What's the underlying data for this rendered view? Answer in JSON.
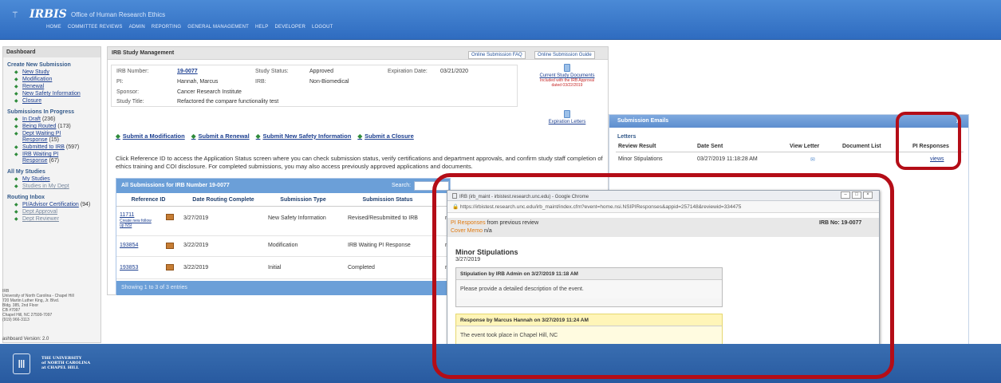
{
  "header": {
    "logo": "IRBIS",
    "subtitle": "Office of Human Research Ethics",
    "nav": [
      "HOME",
      "COMMITTEE REVIEWS",
      "ADMIN",
      "REPORTING",
      "GENERAL MANAGEMENT",
      "HELP",
      "DEVELOPER",
      "LOGOUT"
    ]
  },
  "sidebar": {
    "title": "Dashboard",
    "create_heading": "Create New Submission",
    "create_items": [
      "New Study",
      "Modification",
      "Renewal",
      "New Safety Information",
      "Closure"
    ],
    "progress_heading": "Submissions In Progress",
    "progress_items": [
      {
        "label": "In Draft",
        "count": "(236)"
      },
      {
        "label": "Being Routed",
        "count": "(173)"
      },
      {
        "label": "Dept Waiting PI Response",
        "count": "(15)"
      },
      {
        "label": "Submitted to IRB",
        "count": "(597)"
      },
      {
        "label": "IRB Waiting PI Response",
        "count": "(67)"
      }
    ],
    "studies_heading": "All My Studies",
    "studies_items": [
      "My Studies",
      "Studies in My Dept"
    ],
    "routing_heading": "Routing Inbox",
    "routing_items": [
      {
        "label": "PI/Advisor Certification",
        "count": "(94)"
      },
      {
        "label": "Dept Approval",
        "count": ""
      },
      {
        "label": "Dept Reviewer",
        "count": ""
      }
    ],
    "address_lines": [
      "IRB",
      "University of North Carolina - Chapel Hill",
      "720 Martin Luther King, Jr. Blvd.",
      "Bldg. 385, 2nd Floor",
      "CB #7097",
      "Chapel Hill, NC 27599-7097",
      "(919) 966-3113"
    ],
    "version": "ashboard Version: 2.0"
  },
  "main": {
    "title": "IRB Study Management",
    "faq_button": "Online Submission FAQ",
    "guide_button": "Online Submission Guide",
    "study": {
      "irb_number_label": "IRB Number:",
      "irb_number": "19-0077",
      "status_label": "Study Status:",
      "status": "Approved",
      "expiration_label": "Expiration Date:",
      "expiration": "03/21/2020",
      "pi_label": "PI:",
      "pi": "Hannah, Marcus",
      "irb_label": "IRB:",
      "irb": "Non-Biomedical",
      "sponsor_label": "Sponsor:",
      "sponsor": "Cancer Research Institute",
      "title_label": "Study Title:",
      "title": "Refactored the compare functionality test"
    },
    "docs": {
      "current_link": "Current Study Documents",
      "current_note": "Included with the IRB Approval dated 03/22/2019",
      "expiration_link": "Expiration Letters"
    },
    "sublinks": [
      "Submit a Modification",
      "Submit a Renewal",
      "Submit New Safety Information",
      "Submit a Closure"
    ],
    "description": "Click Reference ID to access the Application Status screen where you can check submission status, verify certifications and department approvals, and confirm study staff completion of ethics training and COI disclosure. For completed submissions, you may also access previously approved applications and documents.",
    "grid": {
      "title": "All Submissions for IRB Number 19-0077",
      "search_label": "Search:",
      "headers": [
        "Reference ID",
        "Date Routing Complete",
        "Submission Type",
        "Submission Status"
      ],
      "rows": [
        {
          "ref": "11711",
          "sub": "Create new follow up NSI",
          "date": "3/27/2019",
          "type": "New Safety Information",
          "status": "Revised/Resubmitted to IRB",
          "extra": "n"
        },
        {
          "ref": "193854",
          "sub": "",
          "date": "3/22/2019",
          "type": "Modification",
          "status": "IRB Waiting PI Response",
          "extra": "n"
        },
        {
          "ref": "193853",
          "sub": "",
          "date": "3/22/2019",
          "type": "Initial",
          "status": "Completed",
          "extra": "n"
        }
      ],
      "footer": "Showing 1 to 3 of 3 entries"
    }
  },
  "emails": {
    "title": "Submission Emails",
    "section": "Letters",
    "headers": [
      "Review Result",
      "Date Sent",
      "View Letter",
      "Document List",
      "PI Responses"
    ],
    "row": {
      "result": "Minor Stipulations",
      "date": "03/27/2019 11:18:28 AM",
      "pi_link": "views"
    }
  },
  "popup": {
    "window_title": "IRB (irb_maint - irbistest.research.unc.edu) - Google Chrome",
    "url": "https://irbistest.research.unc.edu/irb_maint/index.cfm?event=home.nsi.NSIPIResponses&appid=257148&reviewid=334475",
    "pi_responses": "PI Responses",
    "from_prev": "from previous review",
    "cover_memo": "Cover Memo",
    "cover_value": "n/a",
    "irb_no": "IRB No: 19-0077",
    "heading": "Minor Stipulations",
    "date": "3/27/2019",
    "stipulation_header": "Stipulation by IRB Admin on 3/27/2019 11:18 AM",
    "stipulation_text": "Please provide a detailed description of the event.",
    "response_header": "Response by Marcus Hannah on 3/27/2019 11:24 AM",
    "response_text": "The event took place in Chapel Hill, NC"
  },
  "footer": {
    "line1": "THE UNIVERSITY",
    "line2": "of NORTH CAROLINA",
    "line3": "at CHAPEL HILL"
  },
  "colors": {
    "header": "#3b78c9",
    "annotation": "#b40d17",
    "link": "#1a3d8f",
    "grid": "#6b9fd8"
  }
}
